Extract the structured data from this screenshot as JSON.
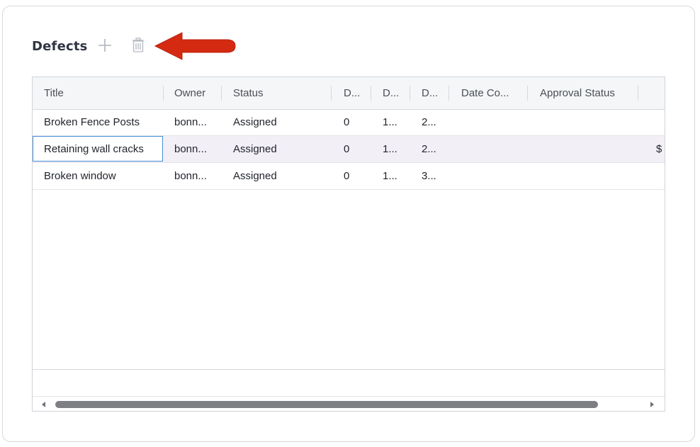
{
  "panel": {
    "title": "Defects",
    "add_icon": "plus-icon",
    "delete_icon": "trash-icon",
    "annotation_arrow_color": "#d42a12"
  },
  "grid": {
    "columns": [
      "Title",
      "Owner",
      "Status",
      "D...",
      "D...",
      "D...",
      "Date Co...",
      "Approval Status"
    ],
    "rows": [
      {
        "title": "Broken Fence Posts",
        "owner": "bonn...",
        "status": "Assigned",
        "d1": "0",
        "d2": "1...",
        "d3": "2...",
        "date_completed": "",
        "approval": "",
        "extra": ""
      },
      {
        "title": "Retaining wall cracks",
        "owner": "bonn...",
        "status": "Assigned",
        "d1": "0",
        "d2": "1...",
        "d3": "2...",
        "date_completed": "",
        "approval": "",
        "extra": "$"
      },
      {
        "title": "Broken window",
        "owner": "bonn...",
        "status": "Assigned",
        "d1": "0",
        "d2": "1...",
        "d3": "3...",
        "date_completed": "",
        "approval": "",
        "extra": ""
      }
    ],
    "selected_row_index": 1,
    "scroll_icons": {
      "left": "triangle-left-icon",
      "right": "triangle-right-icon"
    }
  },
  "colors": {
    "selected_row": "#f3eff7",
    "focus_border": "#4a8fd6",
    "header_bg": "#f5f6f7"
  }
}
